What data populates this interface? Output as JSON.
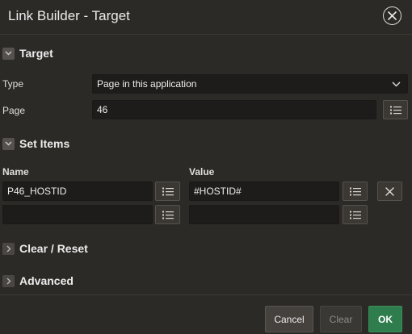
{
  "dialog": {
    "title": "Link Builder - Target"
  },
  "target": {
    "header": "Target",
    "type_label": "Type",
    "type_value": "Page in this application",
    "page_label": "Page",
    "page_value": "46"
  },
  "set_items": {
    "header": "Set Items",
    "name_header": "Name",
    "value_header": "Value",
    "rows": [
      {
        "name": "P46_HOSTID",
        "value": "#HOSTID#"
      },
      {
        "name": "",
        "value": ""
      }
    ]
  },
  "clear_reset": {
    "header": "Clear / Reset"
  },
  "advanced": {
    "header": "Advanced"
  },
  "footer": {
    "cancel_label": "Cancel",
    "clear_label": "Clear",
    "ok_label": "OK"
  },
  "colors": {
    "ok_button": "#2f7d4d",
    "background": "#2c2a27",
    "field": "#1d1c1a"
  }
}
